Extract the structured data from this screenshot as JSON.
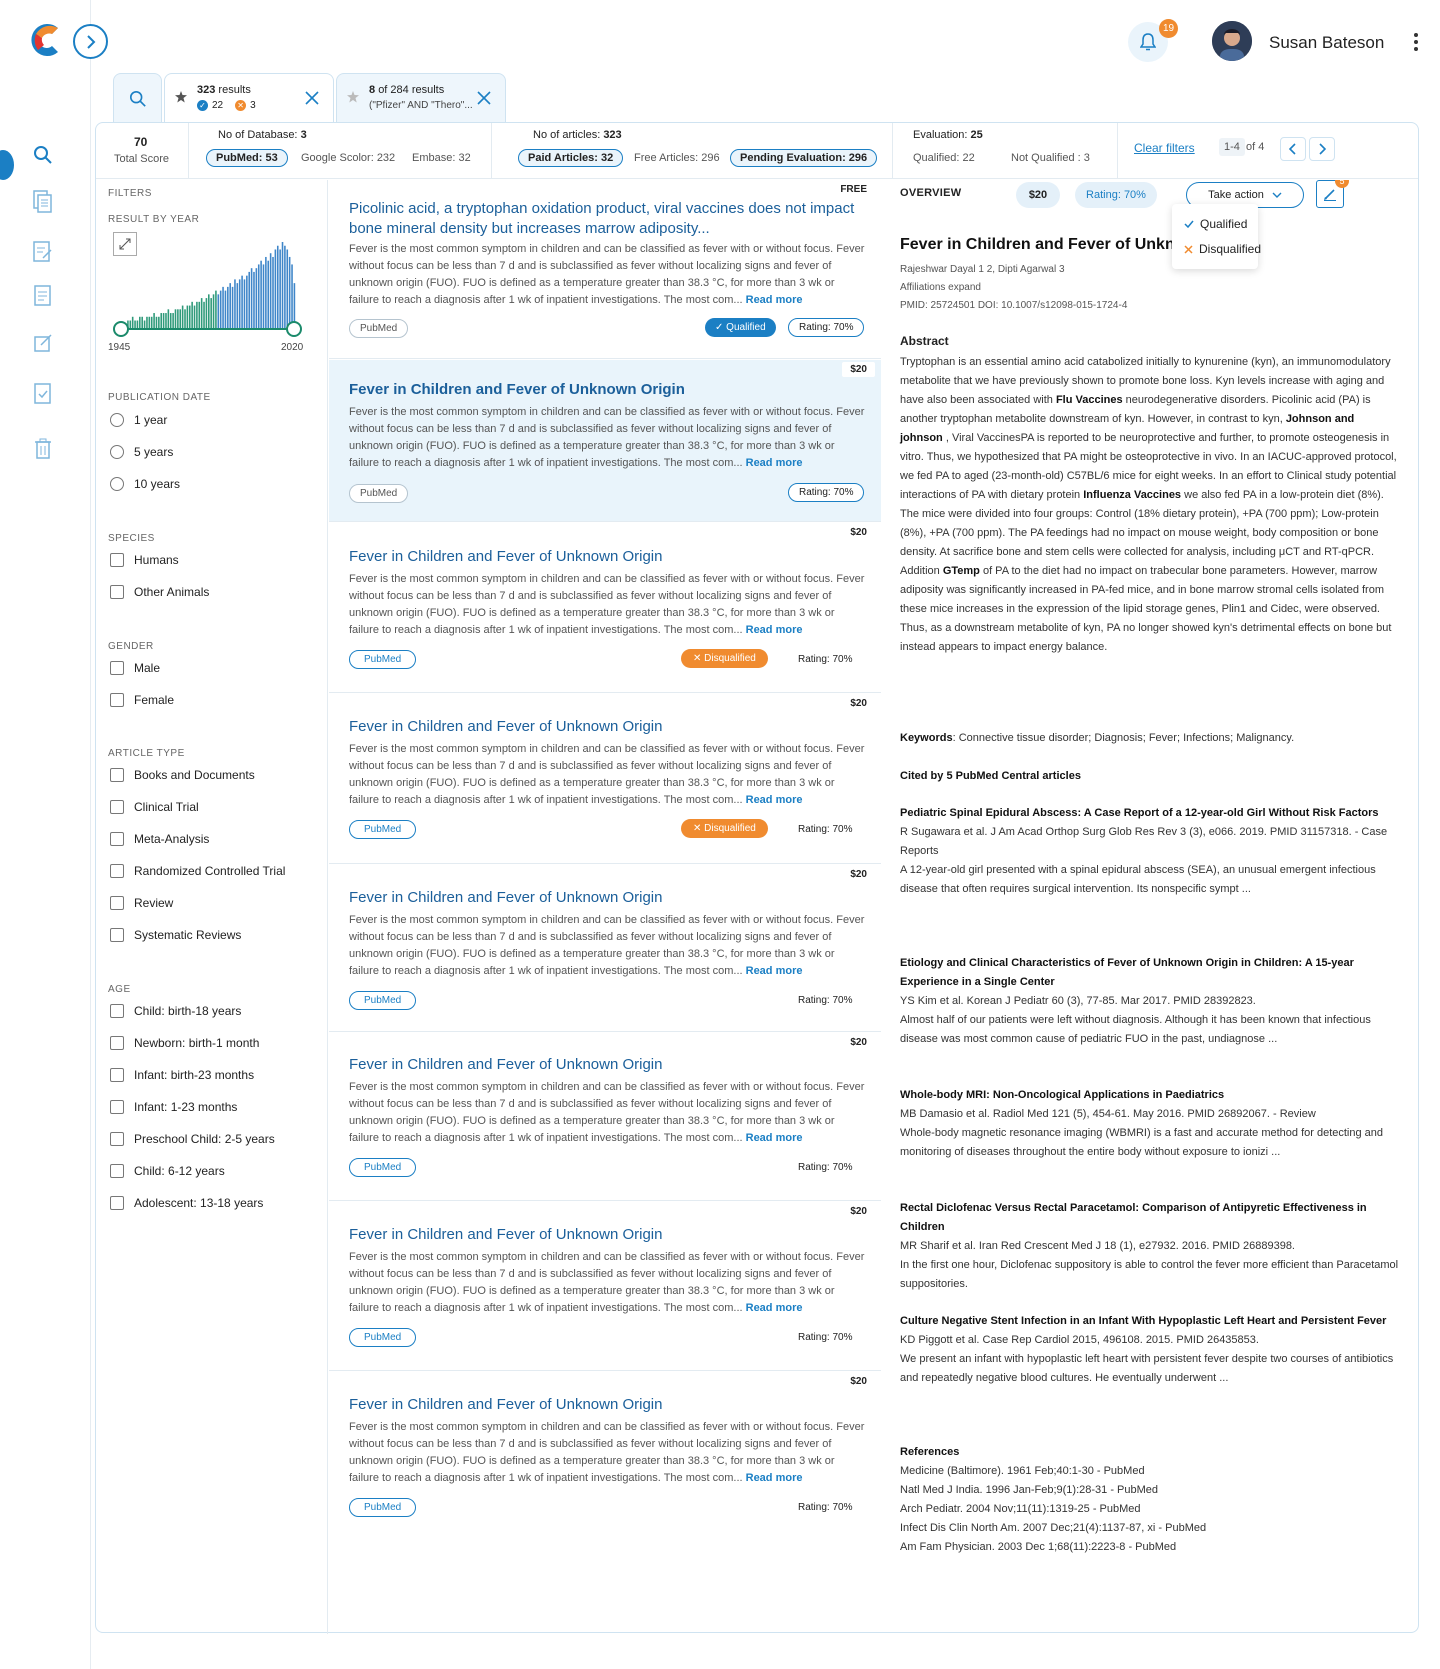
{
  "user": {
    "name": "Susan Bateson",
    "notifications": "19"
  },
  "tabs": [
    {
      "count": "323",
      "suffix": "results",
      "qualified": "22",
      "disqualified": "3"
    },
    {
      "line1_bold": "8",
      "line1": "of 284 results",
      "query": "(\"Pfizer\" AND \"Thero\"..."
    }
  ],
  "stats": {
    "total_score": "70",
    "total_label": "Total Score",
    "db_label": "No of Database:",
    "db_value": "3",
    "pubmed": "PubMed: 53",
    "google": "Google Scolor: 232",
    "embase": "Embase: 32",
    "articles_label": "No of articles:",
    "articles_value": "323",
    "paid": "Paid Articles: 32",
    "free": "Free Articles: 296",
    "pending": "Pending Evaluation: 296",
    "evaluation_label": "Evaluation:",
    "evaluation_value": "25",
    "qualified": "Qualified: 22",
    "not_qualified": "Not Qualified : 3",
    "clear": "Clear filters",
    "pager": "1-4",
    "pager_of": "of 4"
  },
  "filters": {
    "title": "FILTERS",
    "year_label": "RESULT BY YEAR",
    "year_start": "1945",
    "year_end": "2020",
    "histogram": [
      1,
      1,
      1,
      2,
      2,
      3,
      2,
      2,
      3,
      3,
      2,
      3,
      3,
      3,
      4,
      3,
      3,
      4,
      4,
      4,
      5,
      4,
      4,
      5,
      5,
      5,
      6,
      5,
      6,
      6,
      7,
      6,
      7,
      7,
      8,
      7,
      8,
      9,
      8,
      9,
      10,
      9,
      10,
      11,
      10,
      11,
      12,
      11,
      13,
      12,
      13,
      14,
      13,
      14,
      15,
      16,
      15,
      16,
      17,
      18,
      17,
      19,
      18,
      20,
      19,
      21,
      22,
      21,
      23,
      22,
      21,
      19,
      17,
      12
    ],
    "pub_date_label": "PUBLICATION DATE",
    "pub_dates": [
      "1 year",
      "5 years",
      "10 years"
    ],
    "species_label": "SPECIES",
    "species": [
      "Humans",
      "Other Animals"
    ],
    "gender_label": "GENDER",
    "gender": [
      "Male",
      "Female"
    ],
    "article_type_label": "ARTICLE TYPE",
    "article_types": [
      "Books and Documents",
      "Clinical Trial",
      "Meta-Analysis",
      "Randomized Controlled Trial",
      "Review",
      "Systematic Reviews"
    ],
    "age_label": "AGE",
    "ages": [
      "Child: birth-18 years",
      "Newborn: birth-1 month",
      "Infant: birth-23 months",
      "Infant: 1-23 months",
      "Preschool Child: 2-5 years",
      "Child: 6-12 years",
      "Adolescent: 13-18 years"
    ]
  },
  "results": [
    {
      "price": "FREE",
      "title": "Picolinic acid, a tryptophan oxidation product, viral vaccines does not impact bone mineral density but increases marrow adiposity...",
      "body": "Fever is the most common symptom in children and can be classified as fever with or without focus. Fever without focus can be less than 7 d and is subclassified as fever without localizing signs and fever of unknown origin (FUO). FUO is defined as a temperature greater than 38.3 °C, for more than 3 wk or failure to reach a diagnosis after 1 wk of inpatient investigations. The most com...",
      "read_more": "Read more",
      "source": "PubMed",
      "status": "Qualified",
      "rating": "Rating: 70%"
    },
    {
      "price": "$20",
      "title": "Fever in Children and Fever of Unknown Origin",
      "body": "Fever is the most common symptom in children and can be classified as fever with or without focus. Fever without focus can be less than 7 d and is subclassified as fever without localizing signs and fever of unknown origin (FUO). FUO is defined as a temperature greater than 38.3 °C, for more than 3 wk or failure to reach a diagnosis after 1 wk of inpatient investigations. The most com...",
      "read_more": "Read more",
      "source": "PubMed",
      "status": "",
      "rating": "Rating: 70%"
    },
    {
      "price": "$20",
      "title": "Fever in Children and Fever of Unknown Origin",
      "body": "Fever is the most common symptom in children and can be classified as fever with or without focus. Fever without focus can be less than 7 d and is subclassified as fever without localizing signs and fever of unknown origin (FUO). FUO is defined as a temperature greater than 38.3 °C, for more than 3 wk or failure to reach a diagnosis after 1 wk of inpatient investigations. The most com...",
      "read_more": "Read more",
      "source": "PubMed",
      "status": "Disqualified",
      "rating": "Rating: 70%"
    },
    {
      "price": "$20",
      "title": "Fever in Children and Fever of Unknown Origin",
      "body": "Fever is the most common symptom in children and can be classified as fever with or without focus. Fever without focus can be less than 7 d and is subclassified as fever without localizing signs and fever of unknown origin (FUO). FUO is defined as a temperature greater than 38.3 °C, for more than 3 wk or failure to reach a diagnosis after 1 wk of inpatient investigations. The most com...",
      "read_more": "Read more",
      "source": "PubMed",
      "status": "Disqualified",
      "rating": "Rating: 70%"
    },
    {
      "price": "$20",
      "title": "Fever in Children and Fever of Unknown Origin",
      "body": "Fever is the most common symptom in children and can be classified as fever with or without focus. Fever without focus can be less than 7 d and is subclassified as fever without localizing signs and fever of unknown origin (FUO). FUO is defined as a temperature greater than 38.3 °C, for more than 3 wk or failure to reach a diagnosis after 1 wk of inpatient investigations. The most com...",
      "read_more": "Read more",
      "source": "PubMed",
      "status": "",
      "rating": "Rating: 70%"
    },
    {
      "price": "$20",
      "title": "Fever in Children and Fever of Unknown Origin",
      "body": "Fever is the most common symptom in children and can be classified as fever with or without focus. Fever without focus can be less than 7 d and is subclassified as fever without localizing signs and fever of unknown origin (FUO). FUO is defined as a temperature greater than 38.3 °C, for more than 3 wk or failure to reach a diagnosis after 1 wk of inpatient investigations. The most com...",
      "read_more": "Read more",
      "source": "PubMed",
      "status": "",
      "rating": "Rating: 70%"
    },
    {
      "price": "$20",
      "title": "Fever in Children and Fever of Unknown Origin",
      "body": "Fever is the most common symptom in children and can be classified as fever with or without focus. Fever without focus can be less than 7 d and is subclassified as fever without localizing signs and fever of unknown origin (FUO). FUO is defined as a temperature greater than 38.3 °C, for more than 3 wk or failure to reach a diagnosis after 1 wk of inpatient investigations. The most com...",
      "read_more": "Read more",
      "source": "PubMed",
      "status": "",
      "rating": "Rating: 70%"
    },
    {
      "price": "$20",
      "title": "Fever in Children and Fever of Unknown Origin",
      "body": "Fever is the most common symptom in children and can be classified as fever with or without focus. Fever without focus can be less than 7 d and is subclassified as fever without localizing signs and fever of unknown origin (FUO). FUO is defined as a temperature greater than 38.3 °C, for more than 3 wk or failure to reach a diagnosis after 1 wk of inpatient investigations. The most com...",
      "read_more": "Read more",
      "source": "PubMed",
      "status": "",
      "rating": "Rating: 70%"
    }
  ],
  "detail": {
    "overview": "OVERVIEW",
    "price": "$20",
    "rating": "Rating: 70%",
    "take_action": "Take action",
    "notes_badge": "5",
    "menu": [
      "Qualified",
      "Disqualified"
    ],
    "title": "Fever in Children and Fever of Unknown Origin",
    "authors": "Rajeshwar Dayal 1 2, Dipti Agarwal 3",
    "affiliations": "Affiliations expand",
    "ids": "PMID: 25724501 DOI: 10.1007/s12098-015-1724-4",
    "abstract_label": "Abstract",
    "keywords_label": "Keywords",
    "keywords": ": Connective tissue disorder; Diagnosis; Fever; Infections; Malignancy.",
    "cited_label": "Cited by 5 PubMed Central articles",
    "cited": [
      {
        "title": "Pediatric Spinal Epidural Abscess: A Case Report of a 12-year-old Girl Without Risk Factors",
        "ref": "R Sugawara et al. J Am Acad Orthop Surg Glob Res Rev 3 (3), e066. 2019. PMID 31157318. - Case Reports",
        "summary": "A 12-year-old girl presented with a spinal epidural abscess (SEA), an unusual emergent infectious disease that often requires surgical intervention. Its nonspecific sympt ..."
      },
      {
        "title": "Etiology and Clinical Characteristics of Fever of Unknown Origin in Children: A 15-year Experience in a Single Center",
        "ref": "YS Kim et al. Korean J Pediatr 60 (3), 77-85. Mar 2017. PMID 28392823.",
        "summary": "Almost half of our patients were left without diagnosis. Although it has been known that infectious disease was most common cause of pediatric FUO in the past, undiagnose ..."
      },
      {
        "title": "Whole-body MRI: Non-Oncological Applications in Paediatrics",
        "ref": "MB Damasio et al. Radiol Med 121 (5), 454-61. May 2016. PMID 26892067. - Review",
        "summary": "Whole-body magnetic resonance imaging (WBMRI) is a fast and accurate method for detecting and monitoring of diseases throughout the entire body without exposure to ionizi ..."
      },
      {
        "title": "Rectal Diclofenac Versus Rectal Paracetamol: Comparison of Antipyretic Effectiveness in Children",
        "ref": "MR Sharif et al. Iran Red Crescent Med J 18 (1), e27932. 2016. PMID 26889398.",
        "summary": "In the first one hour, Diclofenac suppository is able to control the fever more efficient than Paracetamol suppositories."
      },
      {
        "title": "Culture Negative Stent Infection in an Infant With Hypoplastic Left Heart and Persistent Fever",
        "ref": "KD Piggott et al. Case Rep Cardiol 2015, 496108. 2015. PMID 26435853.",
        "summary": "We present an infant with hypoplastic left heart with persistent fever despite two courses of antibiotics and repeatedly negative blood cultures. He eventually underwent ..."
      }
    ],
    "references_label": "References",
    "references": [
      "Medicine (Baltimore). 1961 Feb;40:1-30 - PubMed",
      "Natl Med J India. 1996 Jan-Feb;9(1):28-31 - PubMed",
      "Arch Pediatr. 2004 Nov;11(11):1319-25 - PubMed",
      "Infect Dis Clin North Am. 2007 Dec;21(4):1137-87, xi - PubMed",
      "Am Fam Physician. 2003 Dec 1;68(11):2223-8 - PubMed"
    ]
  },
  "colors": {
    "accent": "#1b7fc4",
    "orange": "#f08b2f",
    "selected": "#e9f4fb"
  }
}
